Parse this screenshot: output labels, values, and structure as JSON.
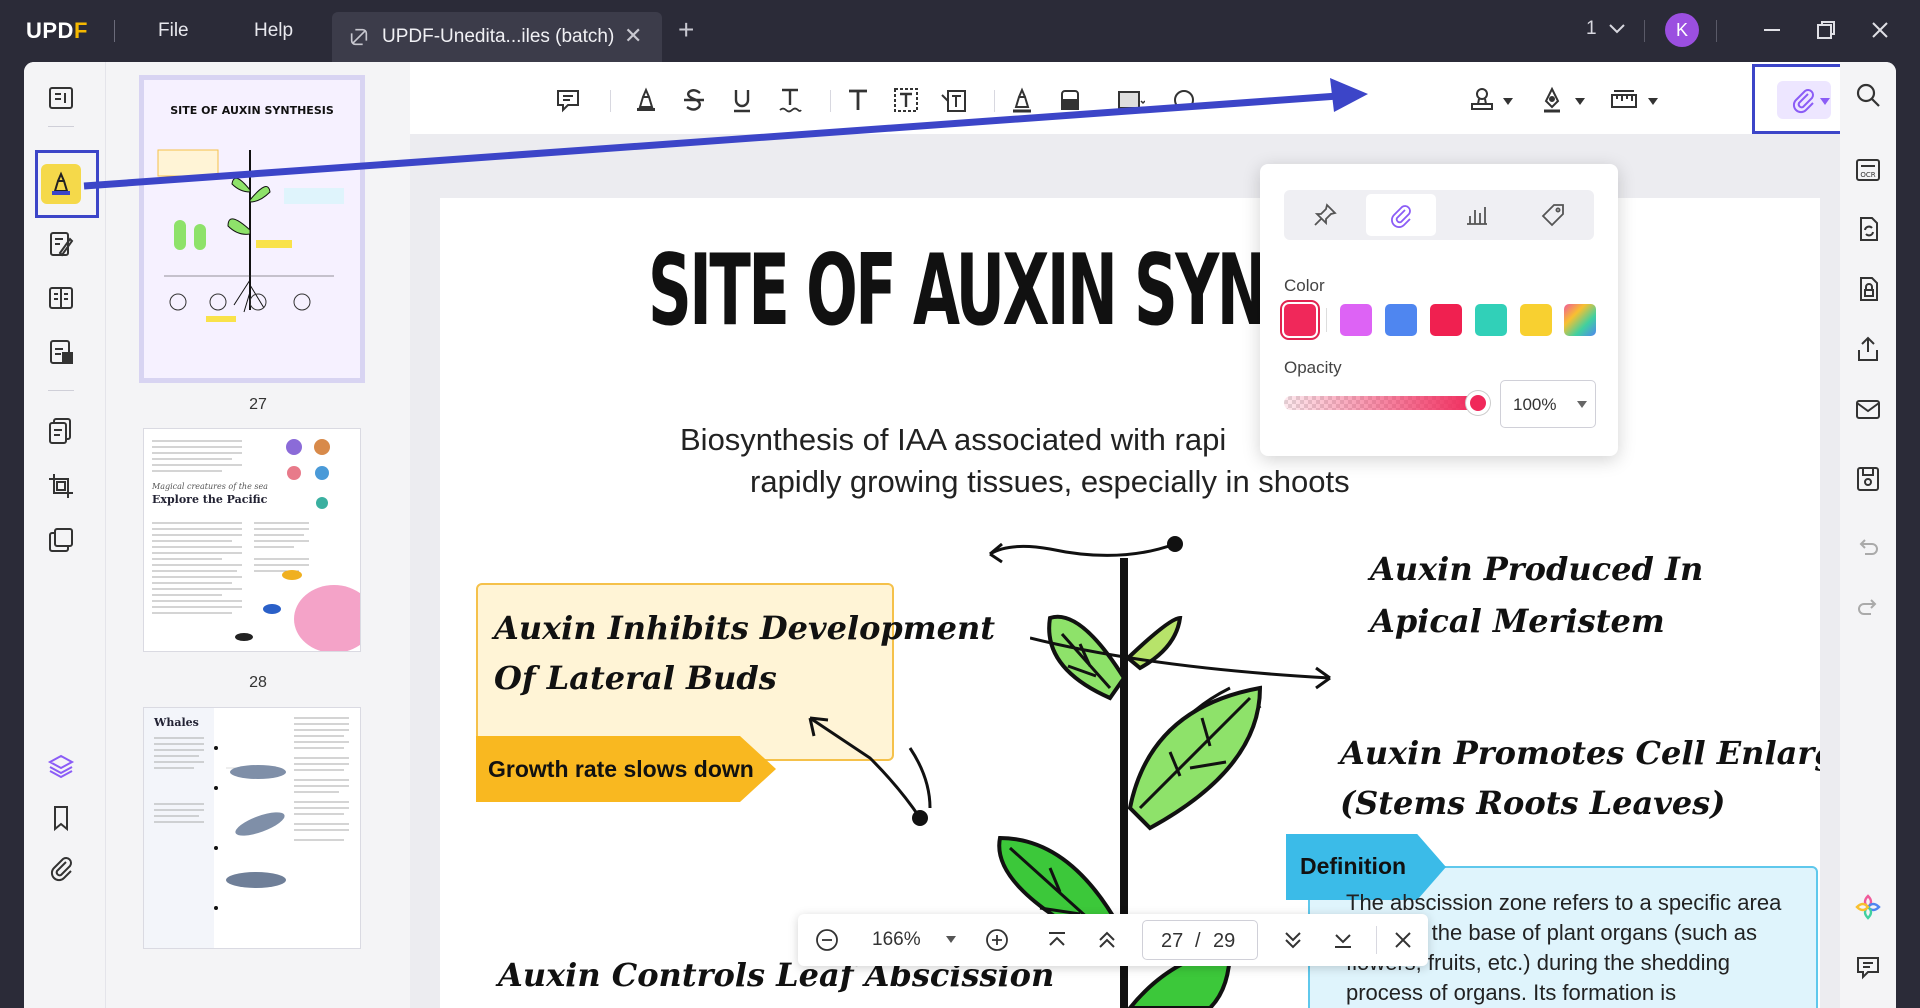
{
  "app": {
    "logo_main": "UPD",
    "logo_accent": "F"
  },
  "menu": {
    "file": "File",
    "help": "Help"
  },
  "tab": {
    "title": "UPDF-Unedita...iles (batch)",
    "close": "✕",
    "add": "+"
  },
  "window": {
    "page_count": "1",
    "avatar_initial": "K"
  },
  "thumbnails": [
    {
      "page": "27",
      "heading": "SITE OF AUXIN SYNTHESIS"
    },
    {
      "page": "28",
      "heading": "Explore the Pacific",
      "kicker": "Magical creatures of the sea"
    },
    {
      "page": "",
      "heading": "Whales"
    }
  ],
  "popup": {
    "tabs": [
      "pin-icon",
      "paperclip-icon",
      "graph-icon",
      "tag-icon"
    ],
    "color_label": "Color",
    "opacity_label": "Opacity",
    "opacity_value": "100%",
    "opacity_level": 1.0,
    "colors": [
      "#f0285a",
      "#dd63f5",
      "#4f86f0",
      "#f02050",
      "#31d0b8",
      "#f8d030",
      "#rainbow"
    ]
  },
  "page": {
    "title": "SITE OF AUXIN SYN",
    "subtitle_line1": "Biosynthesis of IAA associated with rapi",
    "subtitle_line2": "rapidly growing tissues, especially in shoots",
    "yellow_line1": "Auxin Inhibits Development",
    "yellow_line2": "Of Lateral Buds",
    "growth_tag": "Growth rate slows down",
    "apical_line1": "Auxin Produced In",
    "apical_line2": "Apical Meristem",
    "cell_line1": "Auxin Promotes Cell Enlargement",
    "cell_line2": "(Stems Roots Leaves)",
    "leaf_label": "Auxin Controls Leaf Abscission",
    "definition_tag": "Definition",
    "definition_text": "The abscission zone refers to a specific area found at the base of plant organs (such as flowers, fruits, etc.) during the shedding process of organs. Its formation is"
  },
  "zoombar": {
    "zoom": "166%",
    "current_page": "27",
    "separator": "/",
    "total_pages": "29"
  },
  "colors": {
    "accent": "#3c45c8",
    "highlight_active": "#f5d94a",
    "attach_bg": "#ede6ff"
  }
}
